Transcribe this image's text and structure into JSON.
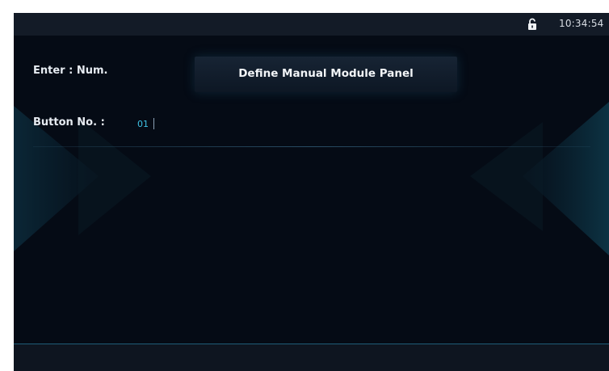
{
  "status_bar": {
    "lock_icon": "unlocked-padlock-icon",
    "time": "10:34:54"
  },
  "panel": {
    "mode_label": "Enter : Num.",
    "title": "Define Manual Module Panel"
  },
  "button_field": {
    "label": "Button No. :",
    "value": "01"
  },
  "colors": {
    "background": "#050b15",
    "accent": "#3ec3e6",
    "text": "#e6ebf1"
  }
}
